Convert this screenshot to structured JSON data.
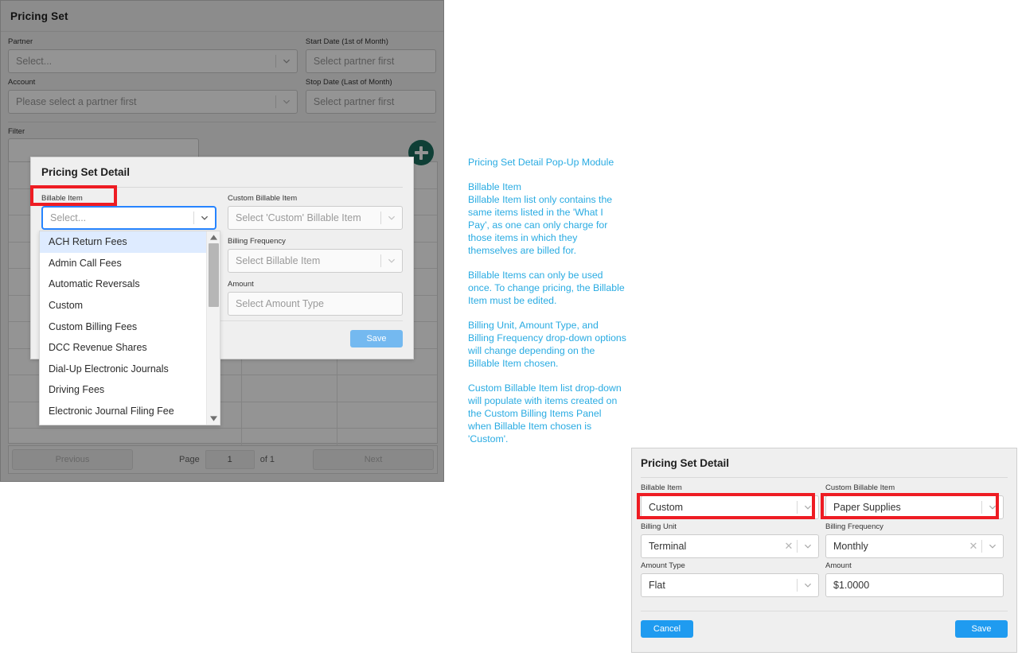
{
  "app": {
    "title": "Pricing Set",
    "fields": {
      "partner_label": "Partner",
      "partner_placeholder": "Select...",
      "account_label": "Account",
      "account_placeholder": "Please select a partner first",
      "start_date_label": "Start Date (1st of Month)",
      "start_date_placeholder": "Select partner first",
      "stop_date_label": "Stop Date (Last of Month)",
      "stop_date_placeholder": "Select partner first",
      "filter_label": "Filter",
      "filter_value": ""
    },
    "add_button_icon": "plus-icon",
    "pager": {
      "previous_label": "Previous",
      "page_label": "Page",
      "page_value": "1",
      "of_label": "of 1",
      "next_label": "Next"
    }
  },
  "modal_top": {
    "title": "Pricing Set Detail",
    "billable_item_label": "Billable Item",
    "billable_item_placeholder": "Select...",
    "custom_billable_item_label": "Custom Billable Item",
    "custom_billable_item_placeholder": "Select 'Custom' Billable Item",
    "billing_frequency_label": "Billing Frequency",
    "billing_frequency_placeholder": "Select Billable Item",
    "amount_label": "Amount",
    "amount_placeholder": "Select Amount Type",
    "save_label": "Save",
    "dropdown_options": [
      "ACH Return Fees",
      "Admin Call Fees",
      "Automatic Reversals",
      "Custom",
      "Custom Billing Fees",
      "DCC Revenue Shares",
      "Dial-Up Electronic Journals",
      "Driving Fees",
      "Electronic Journal Filing Fee"
    ],
    "dropdown_selected_index": 0
  },
  "notes": {
    "heading": "Pricing Set Detail Pop-Up Module",
    "paragraphs": [
      "Billable Item\nBillable Item list only contains the same items listed in the 'What I Pay', as one can only charge for those items in which they themselves are billed for.",
      "Billable Items can only be used once.  To change pricing, the Billable Item must be edited.",
      "Billing Unit, Amount Type, and Billing Frequency drop-down options will change depending on the Billable Item chosen.",
      "Custom Billable Item list drop-down will populate with items created on the Custom Billing Items Panel when Billable Item chosen is 'Custom'."
    ]
  },
  "modal_bottom_right": {
    "title": "Pricing Set Detail",
    "billable_item_label": "Billable Item",
    "billable_item_value": "Custom",
    "custom_billable_item_label": "Custom Billable Item",
    "custom_billable_item_value": "Paper Supplies",
    "billing_unit_label": "Billing Unit",
    "billing_unit_value": "Terminal",
    "billing_frequency_label": "Billing Frequency",
    "billing_frequency_value": "Monthly",
    "amount_type_label": "Amount Type",
    "amount_type_value": "Flat",
    "amount_label": "Amount",
    "amount_value": "$1.0000",
    "cancel_label": "Cancel",
    "save_label": "Save"
  },
  "colors": {
    "highlight_red": "#ee1c23",
    "note_blue": "#29abe2",
    "accent_blue": "#1f9bf0",
    "add_green": "#1a6d5d",
    "focus_blue": "#2684ff",
    "option_selected": "#deebff"
  }
}
